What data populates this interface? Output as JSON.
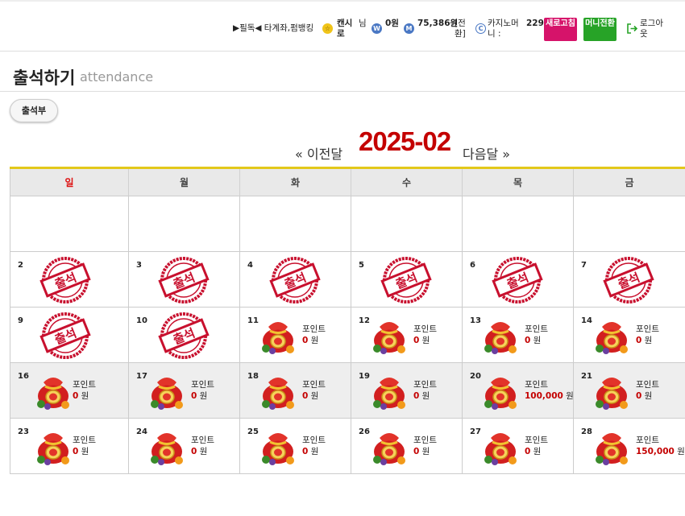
{
  "header": {
    "promo_text": "▶필독◀ 타계좌,펌뱅킹",
    "user_badge": "☆",
    "user_name": "캔시로",
    "user_suffix": "님",
    "wallet": {
      "icon": "W",
      "value": "0원"
    },
    "money": {
      "icon": "M",
      "value": "75,386원",
      "convert_label": "[전환]"
    },
    "casino": {
      "icon": "C",
      "label": "카지노머니 :",
      "value": "229"
    },
    "refresh_label": "새로고침",
    "full_money_label": "머니전환",
    "logout_label": "로그아웃"
  },
  "page": {
    "title": "출석하기",
    "subtitle": "attendance",
    "book_button": "출석부"
  },
  "nav": {
    "prev_label": "« 이전달",
    "month": "2025-02",
    "next_label": "다음달 »"
  },
  "calendar": {
    "weekdays": [
      "일",
      "월",
      "화",
      "수",
      "목",
      "금"
    ],
    "point_label": "포인트",
    "won": "원",
    "stamp_text": "출석",
    "colors": {
      "stamp": "#c8102e",
      "weekday_sun": "#dd1111",
      "point_value": "#c40000",
      "refresh": "#d6136a",
      "money": "#27a327",
      "month": "#c40000"
    },
    "rows": [
      {
        "shaded": false,
        "cells": [
          {
            "type": "empty"
          },
          {
            "type": "empty"
          },
          {
            "type": "empty"
          },
          {
            "type": "empty"
          },
          {
            "type": "empty"
          },
          {
            "type": "empty"
          }
        ]
      },
      {
        "shaded": false,
        "cells": [
          {
            "type": "stamp",
            "day": "2"
          },
          {
            "type": "stamp",
            "day": "3"
          },
          {
            "type": "stamp",
            "day": "4"
          },
          {
            "type": "stamp",
            "day": "5"
          },
          {
            "type": "stamp",
            "day": "6"
          },
          {
            "type": "stamp",
            "day": "7"
          }
        ]
      },
      {
        "shaded": false,
        "cells": [
          {
            "type": "stamp",
            "day": "9"
          },
          {
            "type": "stamp",
            "day": "10"
          },
          {
            "type": "point",
            "day": "11",
            "value": "0"
          },
          {
            "type": "point",
            "day": "12",
            "value": "0"
          },
          {
            "type": "point",
            "day": "13",
            "value": "0"
          },
          {
            "type": "point",
            "day": "14",
            "value": "0"
          }
        ]
      },
      {
        "shaded": true,
        "cells": [
          {
            "type": "point",
            "day": "16",
            "value": "0"
          },
          {
            "type": "point",
            "day": "17",
            "value": "0"
          },
          {
            "type": "point",
            "day": "18",
            "value": "0"
          },
          {
            "type": "point",
            "day": "19",
            "value": "0"
          },
          {
            "type": "point",
            "day": "20",
            "value": "100,000"
          },
          {
            "type": "point",
            "day": "21",
            "value": "0"
          }
        ]
      },
      {
        "shaded": false,
        "cells": [
          {
            "type": "point",
            "day": "23",
            "value": "0"
          },
          {
            "type": "point",
            "day": "24",
            "value": "0"
          },
          {
            "type": "point",
            "day": "25",
            "value": "0"
          },
          {
            "type": "point",
            "day": "26",
            "value": "0"
          },
          {
            "type": "point",
            "day": "27",
            "value": "0"
          },
          {
            "type": "point",
            "day": "28",
            "value": "150,000"
          }
        ]
      }
    ]
  }
}
